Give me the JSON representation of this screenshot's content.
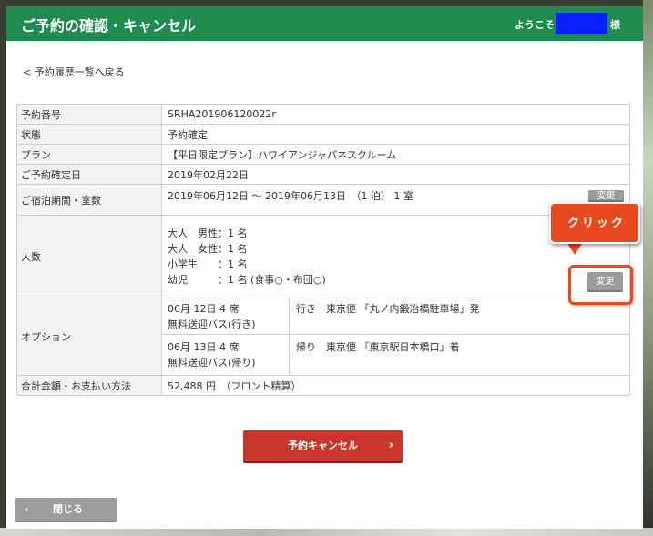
{
  "header": {
    "title": "ご予約の確認・キャンセル",
    "welcome": "ようこそ",
    "honorific": "様"
  },
  "back_link": "< 予約履歴一覧へ戻る",
  "rows": {
    "reservation_no": {
      "label": "予約番号",
      "value": "SRHA201906120022r"
    },
    "status": {
      "label": "状態",
      "value": "予約確定"
    },
    "plan": {
      "label": "プラン",
      "value": "【平日限定プラン】ハワイアンジャパネスクルーム"
    },
    "confirm_date": {
      "label": "ご予約確定日",
      "value": "2019年02月22日"
    },
    "stay": {
      "label": "ご宿泊期間・室数",
      "value": "2019年06月12日 ～ 2019年06月13日　（1 泊） 1 室"
    },
    "guests": {
      "label": "人数",
      "lines": [
        "大人　男性：1 名",
        "大人　女性：1 名",
        "小学生　　：1 名",
        "幼児　　　：1 名 (食事○・布団○)"
      ]
    },
    "option": {
      "label": "オプション",
      "items": [
        {
          "date": "06月 12日 4 席",
          "name": "無料送迎バス(行き)",
          "detail": "行き　東京便 「丸ノ内鍛冶橋駐車場」発"
        },
        {
          "date": "06月 13日 4 席",
          "name": "無料送迎バス(帰り)",
          "detail": "帰り　東京便 「東京駅日本橋口」着"
        }
      ]
    },
    "total": {
      "label": "合計金額・お支払い方法",
      "value": "52,488 円　（フロント精算）"
    }
  },
  "buttons": {
    "change_stay": "変更",
    "change_guests": "変更",
    "cancel": "予約キャンセル",
    "cancel_arrow": "›",
    "close": "閉じる",
    "close_arrow": "‹"
  },
  "callout": {
    "text": "クリック"
  },
  "colors": {
    "header": "#1e8c4e",
    "cancel": "#c9362b",
    "callout": "#e8491f",
    "gray_button": "#9b9b9b"
  }
}
